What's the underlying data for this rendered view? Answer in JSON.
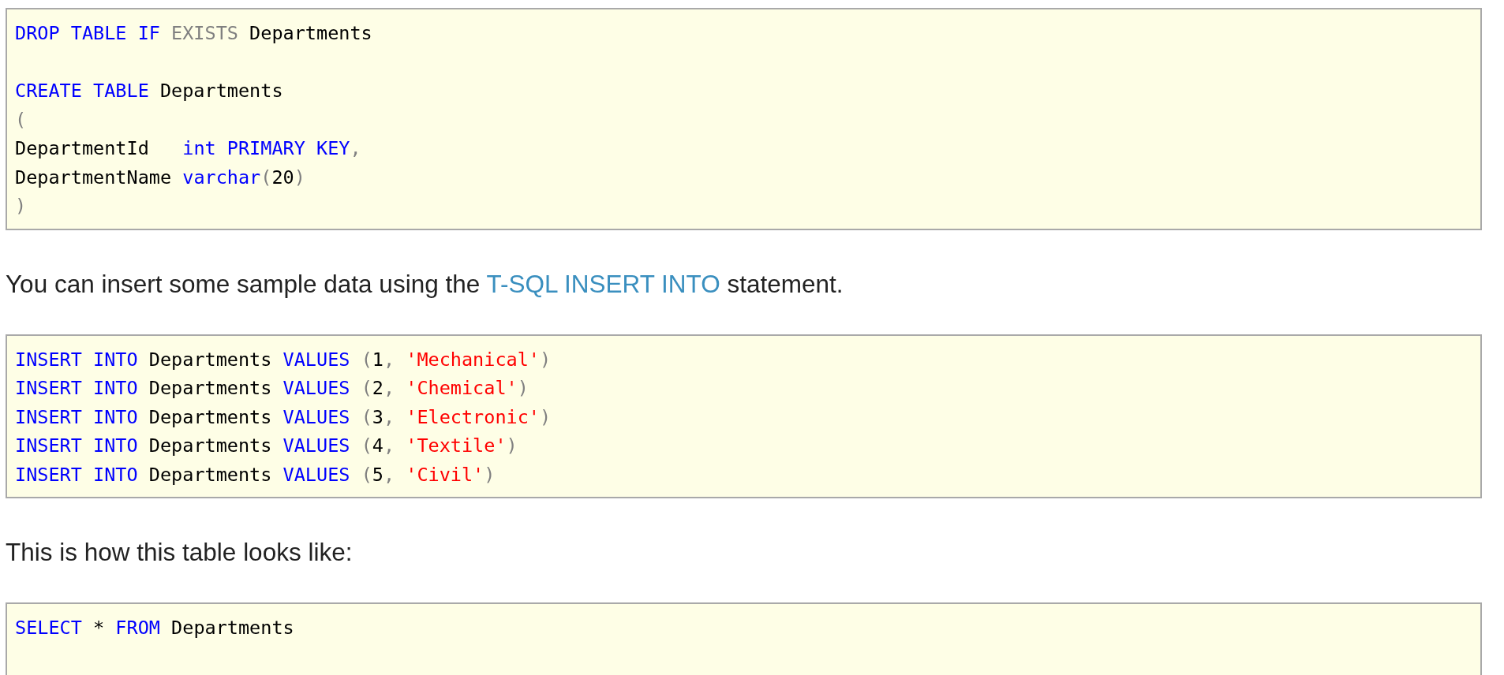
{
  "content": [
    {
      "kind": "code",
      "lines": [
        {
          "kind": "code",
          "tokens": [
            {
              "kind": "keyword",
              "t": "DROP TABLE IF "
            },
            {
              "kind": "operator",
              "t": "EXISTS"
            },
            {
              "kind": "plain",
              "t": " Departments"
            }
          ]
        },
        {
          "kind": "blank"
        },
        {
          "kind": "code",
          "tokens": [
            {
              "kind": "keyword",
              "t": "CREATE TABLE"
            },
            {
              "kind": "plain",
              "t": " Departments"
            }
          ]
        },
        {
          "kind": "code",
          "tokens": [
            {
              "kind": "operator",
              "t": "("
            }
          ]
        },
        {
          "kind": "code",
          "tokens": [
            {
              "kind": "plain",
              "t": "DepartmentId   "
            },
            {
              "kind": "keyword",
              "t": "int PRIMARY KEY"
            },
            {
              "kind": "operator",
              "t": ","
            }
          ]
        },
        {
          "kind": "code",
          "tokens": [
            {
              "kind": "plain",
              "t": "DepartmentName "
            },
            {
              "kind": "keyword",
              "t": "varchar"
            },
            {
              "kind": "operator",
              "t": "("
            },
            {
              "kind": "plain",
              "t": "20"
            },
            {
              "kind": "operator",
              "t": ")"
            }
          ]
        },
        {
          "kind": "code",
          "tokens": [
            {
              "kind": "operator",
              "t": ")"
            }
          ]
        }
      ]
    },
    {
      "kind": "paragraph",
      "parts": [
        {
          "kind": "text",
          "t": "You can insert some sample data using the "
        },
        {
          "kind": "link",
          "t": "T-SQL INSERT INTO"
        },
        {
          "kind": "text",
          "t": " statement."
        }
      ]
    },
    {
      "kind": "code",
      "lines": [
        {
          "kind": "code",
          "tokens": [
            {
              "kind": "keyword",
              "t": "INSERT INTO"
            },
            {
              "kind": "plain",
              "t": " Departments "
            },
            {
              "kind": "keyword",
              "t": "VALUES "
            },
            {
              "kind": "operator",
              "t": "("
            },
            {
              "kind": "plain",
              "t": "1"
            },
            {
              "kind": "operator",
              "t": ", "
            },
            {
              "kind": "string",
              "t": "'Mechanical'"
            },
            {
              "kind": "operator",
              "t": ")"
            }
          ]
        },
        {
          "kind": "code",
          "tokens": [
            {
              "kind": "keyword",
              "t": "INSERT INTO"
            },
            {
              "kind": "plain",
              "t": " Departments "
            },
            {
              "kind": "keyword",
              "t": "VALUES "
            },
            {
              "kind": "operator",
              "t": "("
            },
            {
              "kind": "plain",
              "t": "2"
            },
            {
              "kind": "operator",
              "t": ", "
            },
            {
              "kind": "string",
              "t": "'Chemical'"
            },
            {
              "kind": "operator",
              "t": ")"
            }
          ]
        },
        {
          "kind": "code",
          "tokens": [
            {
              "kind": "keyword",
              "t": "INSERT INTO"
            },
            {
              "kind": "plain",
              "t": " Departments "
            },
            {
              "kind": "keyword",
              "t": "VALUES "
            },
            {
              "kind": "operator",
              "t": "("
            },
            {
              "kind": "plain",
              "t": "3"
            },
            {
              "kind": "operator",
              "t": ", "
            },
            {
              "kind": "string",
              "t": "'Electronic'"
            },
            {
              "kind": "operator",
              "t": ")"
            }
          ]
        },
        {
          "kind": "code",
          "tokens": [
            {
              "kind": "keyword",
              "t": "INSERT INTO"
            },
            {
              "kind": "plain",
              "t": " Departments "
            },
            {
              "kind": "keyword",
              "t": "VALUES "
            },
            {
              "kind": "operator",
              "t": "("
            },
            {
              "kind": "plain",
              "t": "4"
            },
            {
              "kind": "operator",
              "t": ", "
            },
            {
              "kind": "string",
              "t": "'Textile'"
            },
            {
              "kind": "operator",
              "t": ")"
            }
          ]
        },
        {
          "kind": "code",
          "tokens": [
            {
              "kind": "keyword",
              "t": "INSERT INTO"
            },
            {
              "kind": "plain",
              "t": " Departments "
            },
            {
              "kind": "keyword",
              "t": "VALUES "
            },
            {
              "kind": "operator",
              "t": "("
            },
            {
              "kind": "plain",
              "t": "5"
            },
            {
              "kind": "operator",
              "t": ", "
            },
            {
              "kind": "string",
              "t": "'Civil'"
            },
            {
              "kind": "operator",
              "t": ")"
            }
          ]
        }
      ]
    },
    {
      "kind": "paragraph",
      "parts": [
        {
          "kind": "text",
          "t": "This is how this table looks like:"
        }
      ]
    },
    {
      "kind": "code",
      "lines": [
        {
          "kind": "code",
          "tokens": [
            {
              "kind": "keyword",
              "t": "SELECT "
            },
            {
              "kind": "plain",
              "t": "* "
            },
            {
              "kind": "keyword",
              "t": "FROM"
            },
            {
              "kind": "plain",
              "t": " Departments"
            }
          ]
        },
        {
          "kind": "blank"
        }
      ]
    }
  ]
}
